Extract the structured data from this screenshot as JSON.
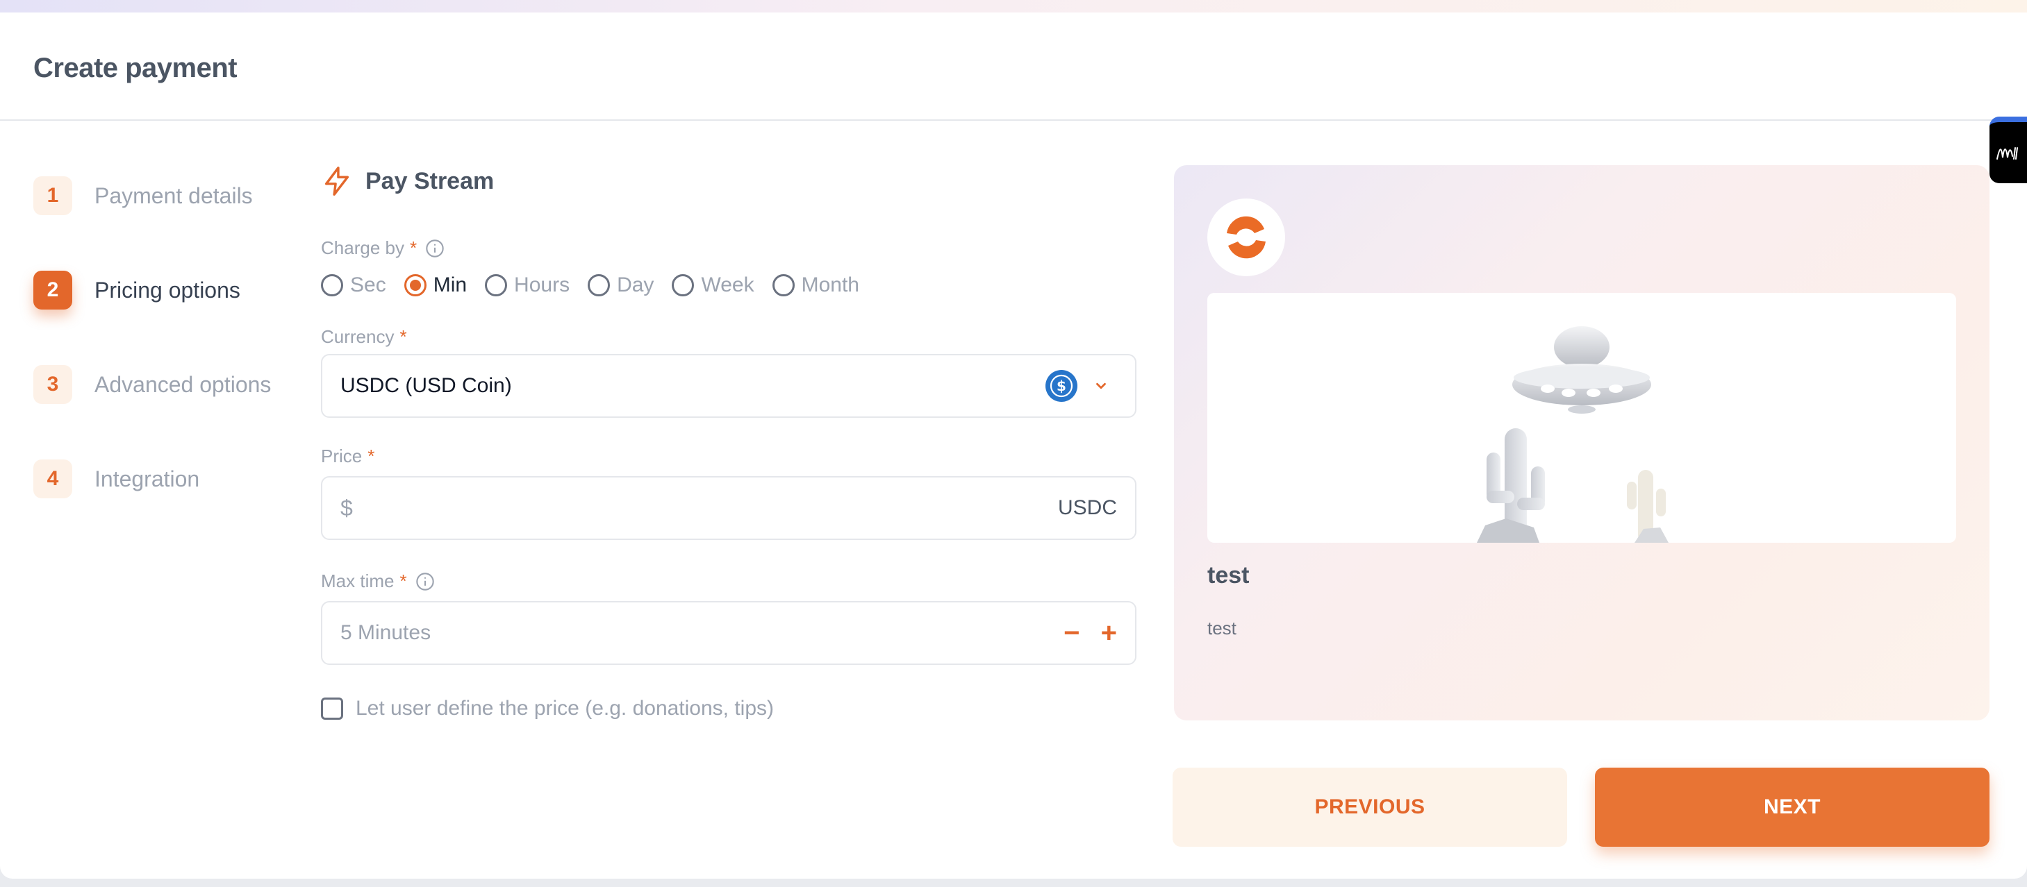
{
  "header": {
    "title": "Create payment"
  },
  "steps": [
    {
      "num": "1",
      "label": "Payment details"
    },
    {
      "num": "2",
      "label": "Pricing options"
    },
    {
      "num": "3",
      "label": "Advanced options"
    },
    {
      "num": "4",
      "label": "Integration"
    }
  ],
  "active_step": 2,
  "section": {
    "title": "Pay Stream",
    "icon": "bolt-icon"
  },
  "charge_by": {
    "label": "Charge by",
    "required": "*",
    "options": [
      "Sec",
      "Min",
      "Hours",
      "Day",
      "Week",
      "Month"
    ],
    "selected": "Min"
  },
  "currency": {
    "label": "Currency",
    "required": "*",
    "value": "USDC (USD Coin)",
    "icon": "usdc-coin-icon"
  },
  "price": {
    "label": "Price",
    "required": "*",
    "prefix": "$",
    "value": "",
    "suffix": "USDC"
  },
  "max_time": {
    "label": "Max time",
    "required": "*",
    "placeholder": "5 Minutes",
    "minus": "−",
    "plus": "+"
  },
  "custom_price": {
    "label": "Let user define the price (e.g. donations, tips)",
    "checked": false
  },
  "preview": {
    "title": "test",
    "description": "test"
  },
  "buttons": {
    "previous": "PREVIOUS",
    "next": "NEXT"
  },
  "colors": {
    "accent": "#e3672b",
    "accent_light": "#fdf1e7",
    "usdc_blue": "#2775ca"
  }
}
